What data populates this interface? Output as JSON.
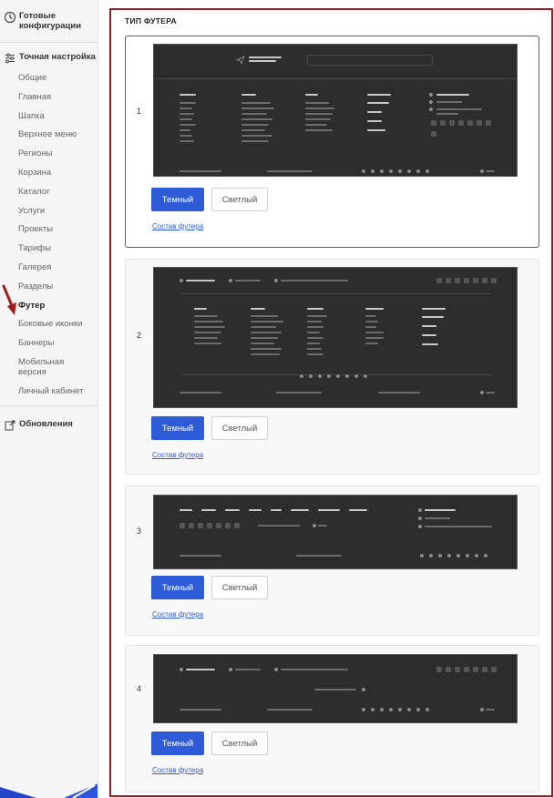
{
  "sidebar": {
    "section_ready": "Готовые конфигурации",
    "section_fine": "Точная настройка",
    "items": [
      "Общие",
      "Главная",
      "Шапка",
      "Верхнее меню",
      "Регионы",
      "Корзина",
      "Каталог",
      "Услуги",
      "Проекты",
      "Тарифы",
      "Галерея",
      "Разделы",
      "Футер",
      "Боковые иконки",
      "Баннеры",
      "Мобильная версия",
      "Личный кабинет"
    ],
    "active_item": "Футер",
    "section_updates": "Обновления"
  },
  "main": {
    "title": "ТИП ФУТЕРА",
    "dark_label": "Темный",
    "light_label": "Светлый",
    "compose_label": "Состав футера",
    "options": [
      {
        "number": "1",
        "selected": true
      },
      {
        "number": "2",
        "selected": false
      },
      {
        "number": "3",
        "selected": false
      },
      {
        "number": "4",
        "selected": false
      }
    ]
  },
  "colors": {
    "accent": "#2e5bd8",
    "highlight_border": "#9b1c23",
    "preview_bg": "#2d2d2d"
  },
  "icons": [
    "ready-config-icon",
    "settings-sliders-icon",
    "updates-icon",
    "red-arrow-indicator"
  ]
}
